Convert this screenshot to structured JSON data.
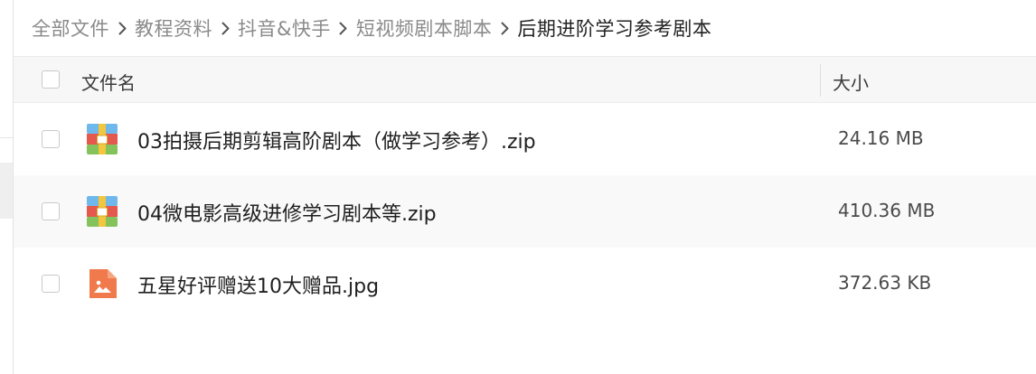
{
  "breadcrumb": {
    "items": [
      "全部文件",
      "教程资料",
      "抖音&快手",
      "短视频剧本脚本",
      "后期进阶学习参考剧本"
    ]
  },
  "table": {
    "columns": {
      "name": "文件名",
      "size": "大小"
    },
    "rows": [
      {
        "name": "03拍摄后期剪辑高阶剧本（做学习参考）.zip",
        "size": "24.16 MB",
        "icon": "zip-archive-icon"
      },
      {
        "name": "04微电影高级进修学习剧本等.zip",
        "size": "410.36 MB",
        "icon": "zip-archive-icon"
      },
      {
        "name": "五星好评赠送10大赠品.jpg",
        "size": "372.63 KB",
        "icon": "image-file-icon"
      }
    ]
  },
  "colors": {
    "zip_blue": "#6fb8ec",
    "zip_red": "#e4584d",
    "zip_green": "#84c25b",
    "zip_clasp": "#f3c63f",
    "image_orange": "#f07a4b"
  }
}
